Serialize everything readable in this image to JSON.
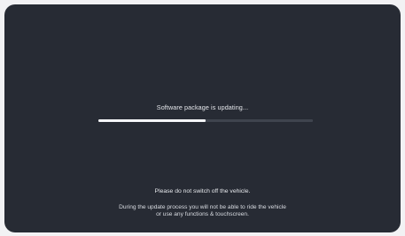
{
  "update": {
    "status_text": "Software package is updating...",
    "progress_fraction": 0.5,
    "warning_text": "Please do not switch off the vehicle.",
    "info_line1": "During the update process you will not be able to ride the vehicle",
    "info_line2": "or use any functions & touchscreen."
  },
  "colors": {
    "screen_bg": "#272b34",
    "progress_track": "#3f444e",
    "progress_fill": "#f4f5f7"
  }
}
